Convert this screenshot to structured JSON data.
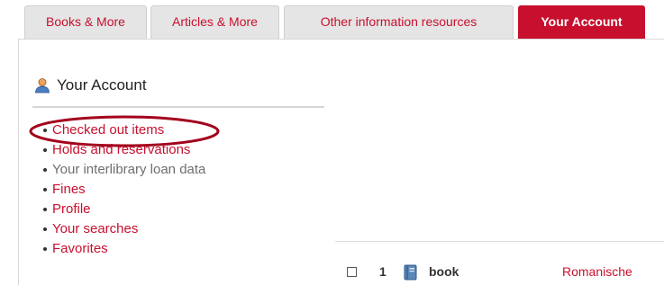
{
  "tabs": [
    {
      "label": "Books & More",
      "active": false
    },
    {
      "label": "Articles & More",
      "active": false
    },
    {
      "label": "Other information resources",
      "active": false
    },
    {
      "label": "Your Account",
      "active": true
    }
  ],
  "account": {
    "heading": "Your Account",
    "heading_icon": "user-icon",
    "menu": [
      {
        "label": "Checked out items",
        "type": "link",
        "highlighted": true
      },
      {
        "label": "Holds and reservations",
        "type": "link"
      },
      {
        "label": "Your interlibrary loan data",
        "type": "muted"
      },
      {
        "label": "Fines",
        "type": "link"
      },
      {
        "label": "Profile",
        "type": "link"
      },
      {
        "label": "Your searches",
        "type": "link"
      },
      {
        "label": "Favorites",
        "type": "link"
      }
    ]
  },
  "results": [
    {
      "number": "1",
      "type": "book",
      "type_icon": "book-icon",
      "title": "Romanische"
    }
  ],
  "colors": {
    "accent": "#c8102e",
    "tab_inactive_bg": "#e5e5e5",
    "highlight": "#a3001c"
  }
}
